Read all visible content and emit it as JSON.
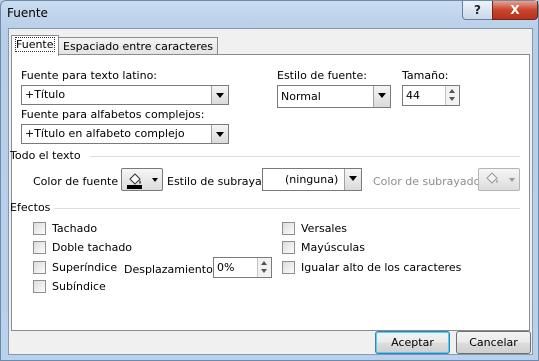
{
  "window": {
    "title": "Fuente",
    "help": "?",
    "close": "X"
  },
  "tabs": [
    "Fuente",
    "Espaciado entre caracteres"
  ],
  "latin_font": {
    "label": "Fuente para texto latino:",
    "value": "+Título"
  },
  "complex_font": {
    "label": "Fuente para alfabetos complejos:",
    "value": "+Título en alfabeto complejo"
  },
  "font_style": {
    "label": "Estilo de fuente:",
    "value": "Normal"
  },
  "font_size": {
    "label": "Tamaño:",
    "value": "44"
  },
  "all_text": {
    "heading": "Todo el texto",
    "font_color_label": "Color de fuente",
    "underline_style_label": "Estilo de subrayado",
    "underline_style_value": "(ninguna)",
    "underline_color_label": "Color de subrayado"
  },
  "effects": {
    "heading": "Efectos",
    "strikethrough": "Tachado",
    "double_strikethrough": "Doble tachado",
    "superscript": "Superíndice",
    "subscript": "Subíndice",
    "offset_label": "Desplazamiento:",
    "offset_value": "0%",
    "small_caps": "Versales",
    "all_caps": "Mayúsculas",
    "equalize": "Igualar alto de los caracteres"
  },
  "buttons": {
    "ok": "Aceptar",
    "cancel": "Cancelar"
  },
  "colors": {
    "font_color": "#000000",
    "accent": "#3c7fb1"
  }
}
